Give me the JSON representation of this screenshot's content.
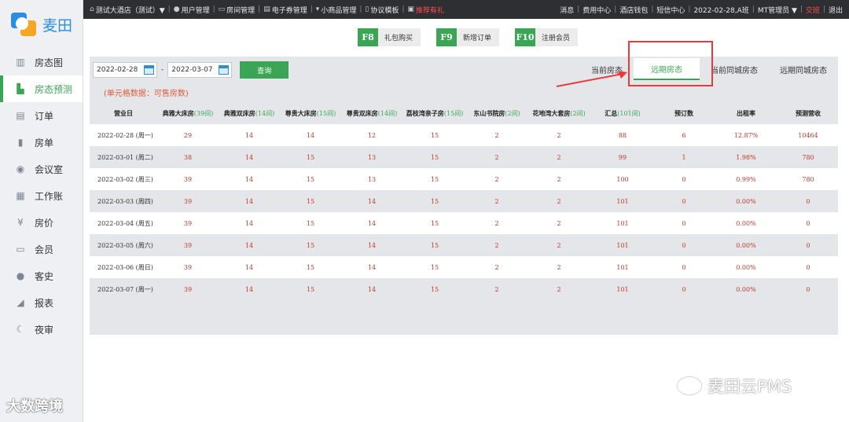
{
  "logo": {
    "text": "麦田"
  },
  "sidebar": {
    "items": [
      {
        "label": "房态图",
        "icon": "building-icon"
      },
      {
        "label": "房态预测",
        "icon": "chart-icon",
        "active": true
      },
      {
        "label": "订单",
        "icon": "order-icon"
      },
      {
        "label": "房单",
        "icon": "file-icon"
      },
      {
        "label": "会议室",
        "icon": "meeting-icon"
      },
      {
        "label": "工作账",
        "icon": "ledger-icon"
      },
      {
        "label": "房价",
        "icon": "price-icon"
      },
      {
        "label": "会员",
        "icon": "card-icon"
      },
      {
        "label": "客史",
        "icon": "person-icon"
      },
      {
        "label": "报表",
        "icon": "report-icon"
      },
      {
        "label": "夜审",
        "icon": "moon-icon"
      }
    ]
  },
  "topbar": {
    "hotel": "测试大酒店（测试）▼",
    "items": [
      "用户管理",
      "房间管理",
      "电子券管理",
      "小商品管理",
      "协议模板"
    ],
    "highlight": "推荐有礼",
    "right": {
      "messages": "消息",
      "fee_center": "费用中心",
      "wallet": "酒店钱包",
      "sms": "短信中心",
      "shift": "2022-02-28,A班",
      "user": "MT管理员 ▼",
      "handover": "交班",
      "logout": "退出"
    }
  },
  "shortcuts": [
    {
      "key": "F8",
      "label": "礼包购买"
    },
    {
      "key": "F9",
      "label": "新增订单"
    },
    {
      "key": "F10",
      "label": "注册会员"
    }
  ],
  "filter": {
    "start": "2022-02-28",
    "end": "2022-03-07",
    "dash": "-",
    "query": "查询"
  },
  "tabs": [
    "当前房态",
    "远期房态",
    "当前同城房态",
    "远期同城房态"
  ],
  "unit_note": "(单元格数据：可售房数)",
  "columns": [
    {
      "name": "营业日",
      "count": ""
    },
    {
      "name": "典雅大床房",
      "count": "(39间)"
    },
    {
      "name": "典雅双床房",
      "count": "(14间)"
    },
    {
      "name": "尊贵大床房",
      "count": "(15间)"
    },
    {
      "name": "尊贵双床房",
      "count": "(14间)"
    },
    {
      "name": "荔枝湾亲子房",
      "count": "(15间)"
    },
    {
      "name": "东山书院房",
      "count": "(2间)"
    },
    {
      "name": "花地湾大套房",
      "count": "(2间)"
    },
    {
      "name": "汇总",
      "count": "(101间)"
    },
    {
      "name": "预订数",
      "count": ""
    },
    {
      "name": "出租率",
      "count": ""
    },
    {
      "name": "预测营收",
      "count": ""
    }
  ],
  "rows": [
    [
      "2022-02-28 (周一)",
      "29",
      "14",
      "14",
      "12",
      "15",
      "2",
      "2",
      "88",
      "6",
      "12.87%",
      "10464"
    ],
    [
      "2022-03-01 (周二)",
      "38",
      "14",
      "15",
      "13",
      "15",
      "2",
      "2",
      "99",
      "1",
      "1.98%",
      "780"
    ],
    [
      "2022-03-02 (周三)",
      "39",
      "14",
      "15",
      "13",
      "15",
      "2",
      "2",
      "100",
      "0",
      "0.99%",
      "780"
    ],
    [
      "2022-03-03 (周四)",
      "39",
      "14",
      "15",
      "14",
      "15",
      "2",
      "2",
      "101",
      "0",
      "0.00%",
      "0"
    ],
    [
      "2022-03-04 (周五)",
      "39",
      "14",
      "15",
      "14",
      "15",
      "2",
      "2",
      "101",
      "0",
      "0.00%",
      "0"
    ],
    [
      "2022-03-05 (周六)",
      "39",
      "14",
      "15",
      "14",
      "15",
      "2",
      "2",
      "101",
      "0",
      "0.00%",
      "0"
    ],
    [
      "2022-03-06 (周日)",
      "39",
      "14",
      "15",
      "14",
      "15",
      "2",
      "2",
      "101",
      "0",
      "0.00%",
      "0"
    ],
    [
      "2022-03-07 (周一)",
      "39",
      "14",
      "15",
      "14",
      "15",
      "2",
      "2",
      "101",
      "0",
      "0.00%",
      "0"
    ]
  ],
  "watermarks": {
    "left": "大数跨境",
    "right": "麦田云PMS"
  },
  "colors": {
    "accent": "#3aa655",
    "topbar": "#2e2f33",
    "value": "#c0392b",
    "highlight_box": "#e83a3a"
  }
}
